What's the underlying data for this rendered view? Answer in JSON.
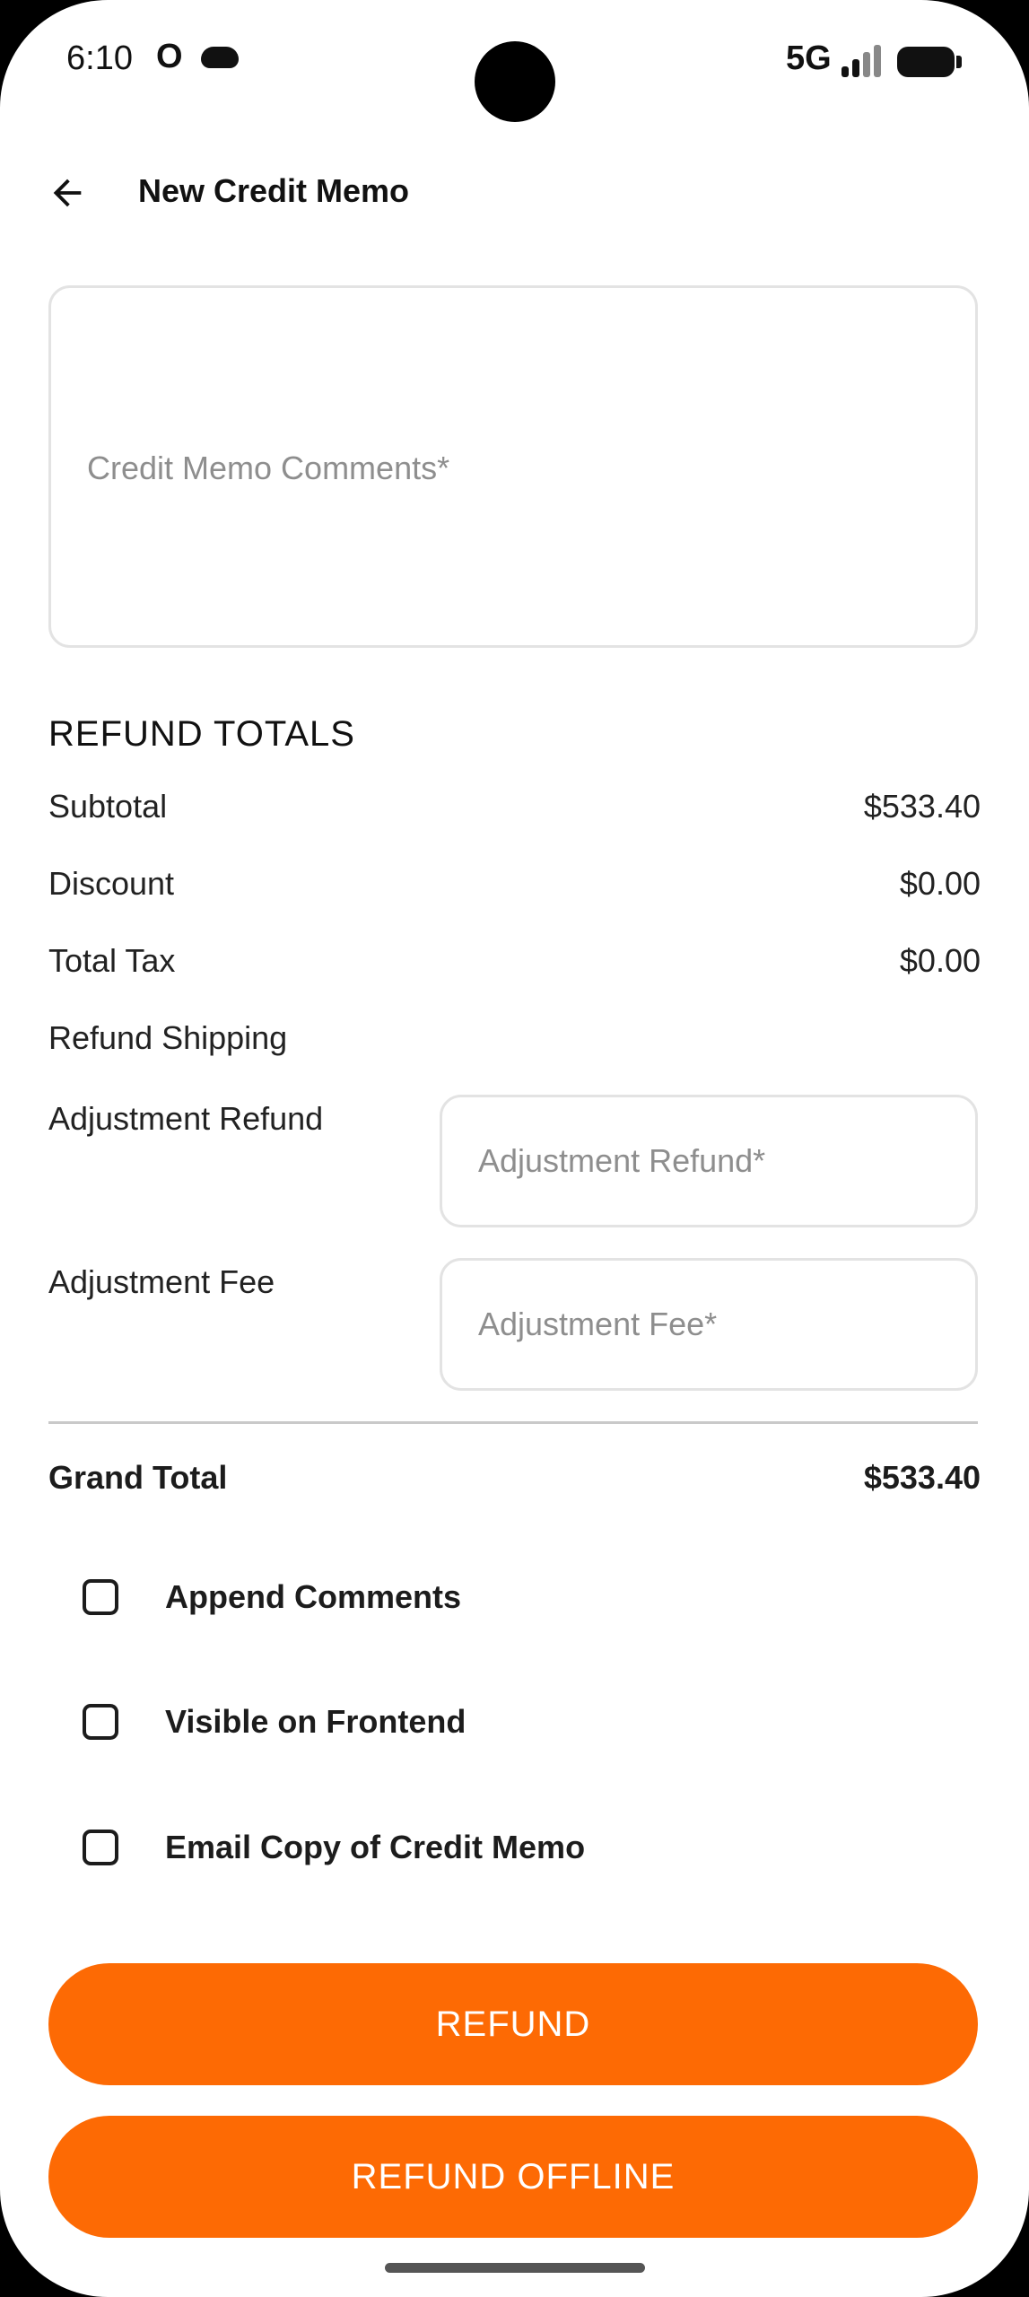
{
  "status_bar": {
    "time": "6:10",
    "o_indicator": "O",
    "network": "5G",
    "icons": [
      "cloud-icon",
      "signal-icon",
      "battery-icon"
    ]
  },
  "app_bar": {
    "title": "New Credit Memo",
    "back_icon": "arrow-left-icon"
  },
  "comments": {
    "placeholder": "Credit Memo Comments*",
    "value": ""
  },
  "refund_totals": {
    "title": "REFUND TOTALS",
    "rows": [
      {
        "label": "Subtotal",
        "value": "$533.40"
      },
      {
        "label": "Discount",
        "value": "$0.00"
      },
      {
        "label": "Total Tax",
        "value": "$0.00"
      },
      {
        "label": "Refund Shipping",
        "value": ""
      }
    ],
    "adjustment_refund": {
      "label": "Adjustment Refund",
      "placeholder": "Adjustment Refund*",
      "value": ""
    },
    "adjustment_fee": {
      "label": "Adjustment Fee",
      "placeholder": "Adjustment Fee*",
      "value": ""
    },
    "grand_total": {
      "label": "Grand Total",
      "value": "$533.40"
    }
  },
  "options": [
    {
      "label": "Append Comments",
      "checked": false
    },
    {
      "label": "Visible on Frontend",
      "checked": false
    },
    {
      "label": "Email Copy of Credit Memo",
      "checked": false
    }
  ],
  "actions": {
    "refund": "REFUND",
    "refund_offline": "REFUND OFFLINE"
  },
  "colors": {
    "accent": "#fd6a04",
    "border": "#e3e3e3",
    "placeholder": "#8e8e8e"
  }
}
